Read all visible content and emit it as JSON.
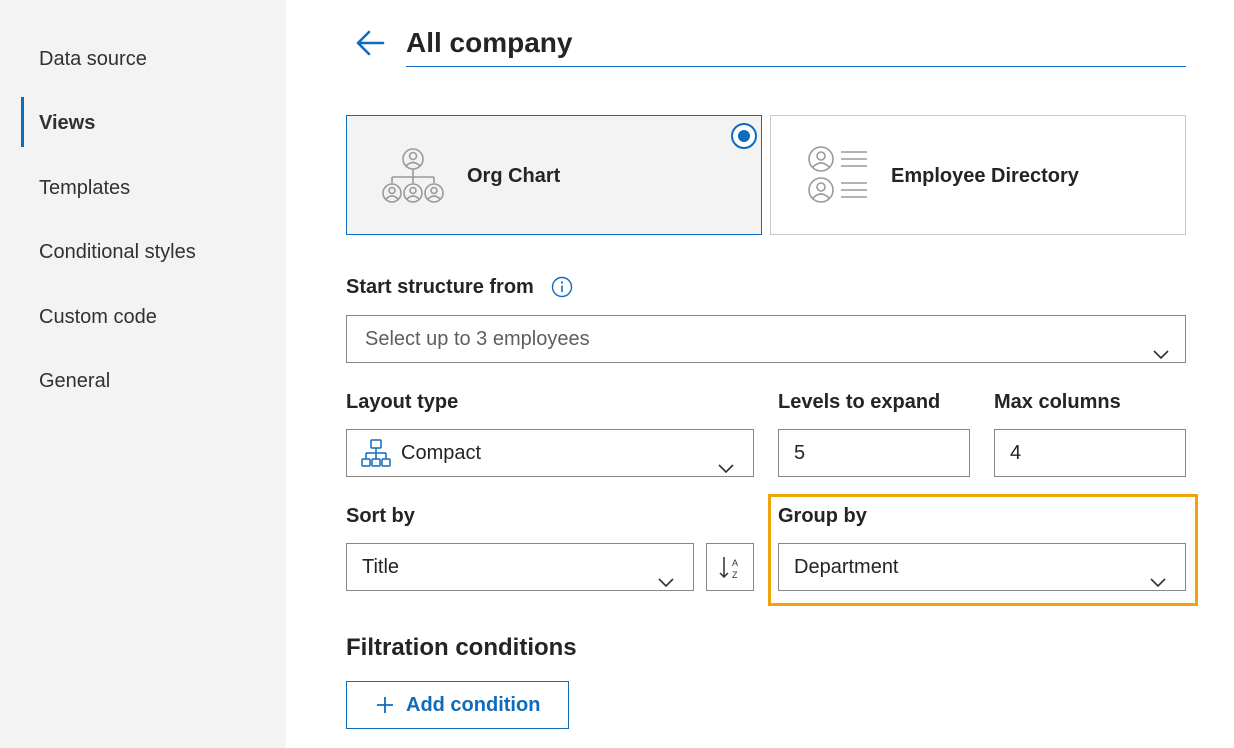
{
  "sidebar": {
    "items": [
      {
        "label": "Data source",
        "active": false
      },
      {
        "label": "Views",
        "active": true
      },
      {
        "label": "Templates",
        "active": false
      },
      {
        "label": "Conditional styles",
        "active": false
      },
      {
        "label": "Custom code",
        "active": false
      },
      {
        "label": "General",
        "active": false
      }
    ]
  },
  "header": {
    "title": "All company"
  },
  "views": [
    {
      "label": "Org Chart",
      "icon": "org-chart-icon",
      "selected": true
    },
    {
      "label": "Employee Directory",
      "icon": "employee-directory-icon",
      "selected": false
    }
  ],
  "start_structure": {
    "label": "Start structure from",
    "placeholder": "Select up to 3 employees"
  },
  "layout_type": {
    "label": "Layout type",
    "value": "Compact",
    "icon": "hierarchy-icon"
  },
  "levels_to_expand": {
    "label": "Levels to expand",
    "value": "5"
  },
  "max_columns": {
    "label": "Max columns",
    "value": "4"
  },
  "sort_by": {
    "label": "Sort by",
    "value": "Title",
    "direction_icon": "sort-ascending-icon"
  },
  "group_by": {
    "label": "Group by",
    "value": "Department"
  },
  "filtration": {
    "title": "Filtration conditions",
    "add_label": "Add condition"
  },
  "colors": {
    "accent": "#0f6cbd",
    "highlight": "#f0a30a",
    "sidebar_bg": "#f3f3f3"
  }
}
